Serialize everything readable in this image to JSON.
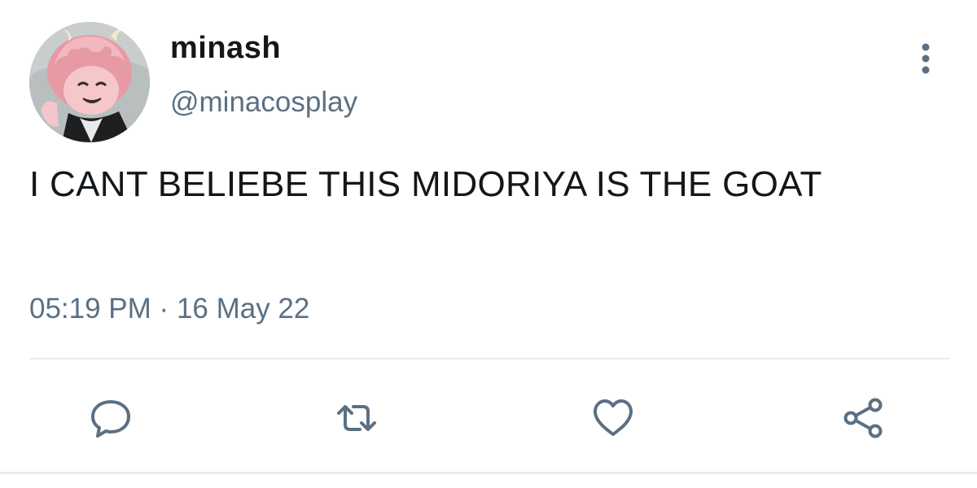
{
  "user": {
    "display_name": "minash",
    "handle": "@minacosplay"
  },
  "tweet": {
    "text": "I CANT BELIEBE THIS MIDORIYA IS THE GOAT",
    "time": "05:19 PM",
    "separator": "·",
    "date": "16 May 22"
  },
  "actions": [
    {
      "icon": "reply-icon"
    },
    {
      "icon": "retweet-icon"
    },
    {
      "icon": "like-icon"
    },
    {
      "icon": "share-icon"
    }
  ],
  "colors": {
    "text": "#14171a",
    "secondary": "#5b7083",
    "divider": "#e6ecf0"
  }
}
